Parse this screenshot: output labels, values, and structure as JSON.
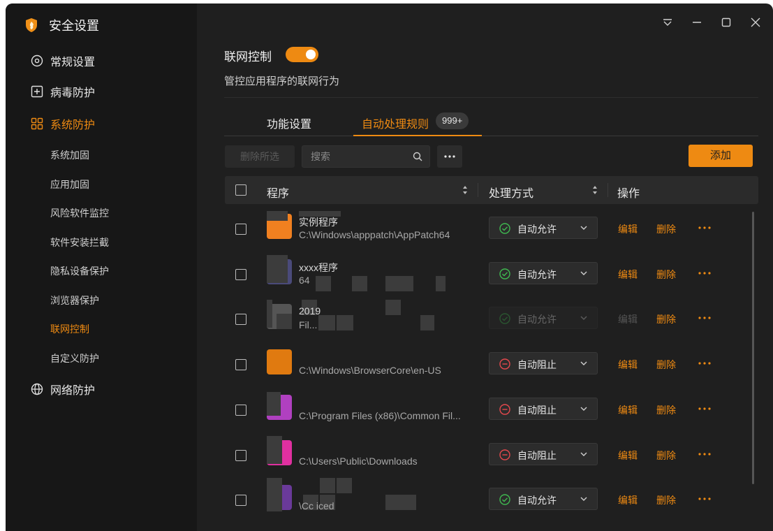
{
  "app": {
    "title": "安全设置",
    "accent": "#ee8a12"
  },
  "sidebar": {
    "nav": [
      {
        "label": "常规设置",
        "icon": "settings-gear-icon"
      },
      {
        "label": "病毒防护",
        "icon": "plus-square-icon"
      },
      {
        "label": "系统防护",
        "icon": "grid-icon",
        "active": true
      },
      {
        "label": "网络防护",
        "icon": "globe-icon"
      }
    ],
    "sub": [
      {
        "label": "系统加固"
      },
      {
        "label": "应用加固"
      },
      {
        "label": "风险软件监控"
      },
      {
        "label": "软件安装拦截"
      },
      {
        "label": "隐私设备保护"
      },
      {
        "label": "浏览器保护"
      },
      {
        "label": "联网控制",
        "active": true
      },
      {
        "label": "自定义防护"
      }
    ]
  },
  "header": {
    "title": "联网控制",
    "toggle_on": true,
    "description": "管控应用程序的联网行为"
  },
  "tabs": [
    {
      "label": "功能设置"
    },
    {
      "label": "自动处理规则",
      "badge": "999+",
      "active": true
    }
  ],
  "toolbar": {
    "delete_selected": "删除所选",
    "search_placeholder": "搜索",
    "add": "添加"
  },
  "table": {
    "columns": {
      "program": "程序",
      "method": "处理方式",
      "operation": "操作"
    },
    "action_edit": "编辑",
    "action_delete": "删除",
    "rows": [
      {
        "name": "实例程序",
        "path": "C:\\Windows\\apppatch\\AppPatch64",
        "method": "自动允许",
        "status": "allow",
        "icon_color": "#f08020"
      },
      {
        "name": "xxxx程序",
        "path": "64",
        "method": "自动允许",
        "status": "allow",
        "icon_color": "#4a4a7a"
      },
      {
        "name": "2019",
        "path": "Fil...",
        "method": "自动允许",
        "status": "allow",
        "disabled": true,
        "icon_color": "#555555"
      },
      {
        "name": "",
        "path": "C:\\Windows\\BrowserCore\\en-US",
        "method": "自动阻止",
        "status": "block",
        "icon_color": "#e07a10"
      },
      {
        "name": "",
        "path": "C:\\Program Files (x86)\\Common Fil...",
        "method": "自动阻止",
        "status": "block",
        "icon_color": "#b040c0"
      },
      {
        "name": "",
        "path": "C:\\Users\\Public\\Downloads",
        "method": "自动阻止",
        "status": "block",
        "icon_color": "#e030a0"
      },
      {
        "name": "",
        "path": "\\Cc  iced",
        "method": "自动允许",
        "status": "allow",
        "icon_color": "#6a3a9a"
      }
    ]
  }
}
